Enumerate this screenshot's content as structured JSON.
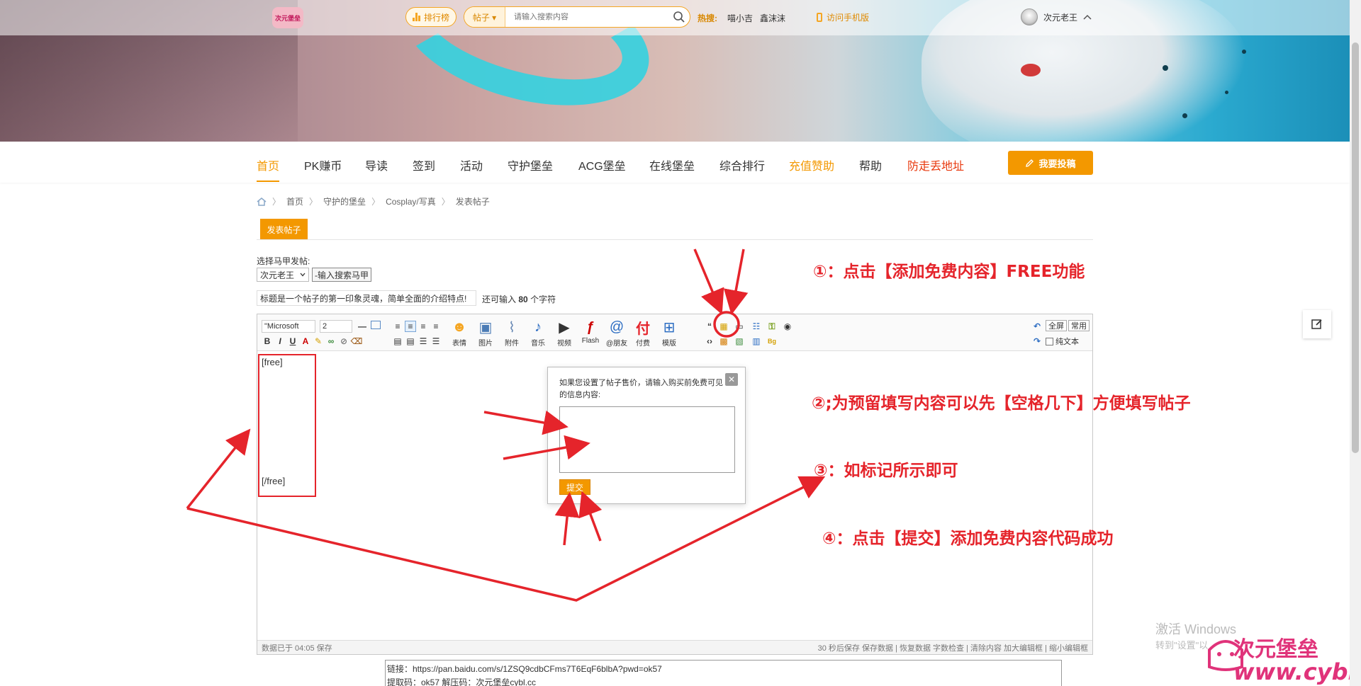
{
  "topbar": {
    "logo_text": "次元堡垒",
    "rank_label": "排行榜",
    "search_category": "帖子 ▾",
    "search_placeholder": "请输入搜索内容",
    "hot_label": "热搜:",
    "hot_items": [
      "喵小吉",
      "鑫沫沫"
    ],
    "mobile_label": "访问手机版",
    "user_name": "次元老王"
  },
  "nav": {
    "items": [
      "首页",
      "PK赚币",
      "导读",
      "签到",
      "活动",
      "守护堡垒",
      "ACG堡垒",
      "在线堡垒",
      "综合排行",
      "充值赞助",
      "帮助",
      "防走丢地址"
    ],
    "post_button": "我要投稿"
  },
  "breadcrumb": [
    "首页",
    "守护的堡垒",
    "Cosplay/写真",
    "发表帖子"
  ],
  "tab_label": "发表帖子",
  "form": {
    "alias_label": "选择马甲发帖:",
    "alias_value": "次元老王",
    "alias_search_btn": "-输入搜索马甲",
    "title_value": "标题是一个帖子的第一印象灵魂，简单全面的介绍特点!",
    "remain_prefix": "还可输入",
    "remain_count": "80",
    "remain_suffix": "个字符"
  },
  "editor": {
    "font_value": "\"Microsoft",
    "size_value": "2",
    "big_tools": [
      "表情",
      "图片",
      "附件",
      "音乐",
      "视频",
      "Flash",
      "@朋友",
      "付费",
      "模版"
    ],
    "right_fullscreen": "全屏",
    "right_common": "常用",
    "plain_text": "纯文本",
    "free_open": "[free]",
    "free_close": "[/free]",
    "status_left": "数据已于 04:05 保存",
    "status_right": "30 秒后保存 保存数据 | 恢复数据    字数检查 | 清除内容    加大编辑框 | 缩小编辑框"
  },
  "popup": {
    "desc": "如果您设置了帖子售价，请输入购买前免费可见的信息内容:",
    "submit": "提交",
    "close": "✕"
  },
  "links": {
    "line1": "链接：https://pan.baidu.com/s/1ZSQ9cdbCFms7T6EqF6blbA?pwd=ok57",
    "line2": "提取码：ok57 解压码：次元堡垒cybl.cc"
  },
  "annotations": {
    "a1": "①：点击【添加免费内容】FREE功能",
    "a2": "②;为预留填写内容可以先【空格几下】方便填写帖子",
    "a3": "③：如标记所示即可",
    "a4": "④：点击【提交】添加免费内容代码成功"
  },
  "system": {
    "activate_title": "激活 Windows",
    "activate_sub": "转到\"设置\"以"
  },
  "watermark": {
    "brand": "次元堡垒",
    "url": "www.cybl.cc"
  },
  "colors": {
    "accent": "#f39800",
    "annotation_red": "#e5242b"
  }
}
